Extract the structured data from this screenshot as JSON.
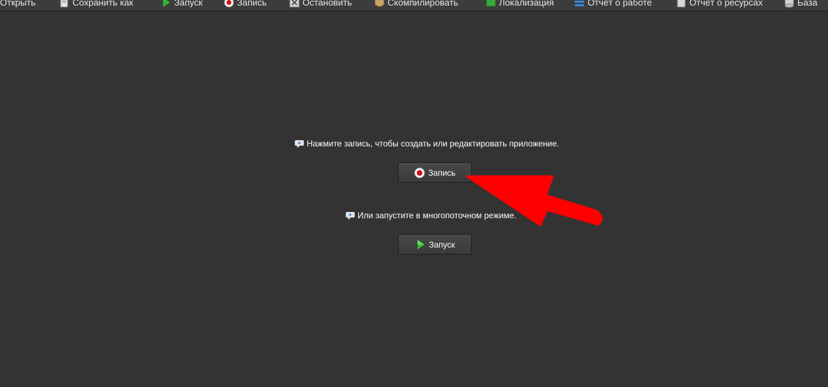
{
  "toolbar": {
    "items": [
      {
        "label": "Открыть",
        "icon": "open-icon"
      },
      {
        "label": "Сохранить как",
        "icon": "save-as-icon"
      },
      {
        "label": "Запуск",
        "icon": "play-icon"
      },
      {
        "label": "Запись",
        "icon": "record-icon"
      },
      {
        "label": "Остановить",
        "icon": "stop-icon"
      },
      {
        "label": "Скомпилировать",
        "icon": "compile-icon"
      },
      {
        "label": "Локализация",
        "icon": "localization-icon"
      },
      {
        "label": "Отчёт о работе",
        "icon": "work-report-icon"
      },
      {
        "label": "Отчёт о ресурсах",
        "icon": "resource-report-icon"
      },
      {
        "label": "База",
        "icon": "database-icon"
      }
    ]
  },
  "main": {
    "record_hint": "Нажмите запись, чтобы создать или редактировать приложение.",
    "record_button": "Запись",
    "run_hint": "Или запустите в многопоточном режиме.",
    "run_button": "Запуск"
  },
  "colors": {
    "background": "#333333",
    "text": "#ffffff",
    "annotation_arrow": "#ff0000"
  }
}
